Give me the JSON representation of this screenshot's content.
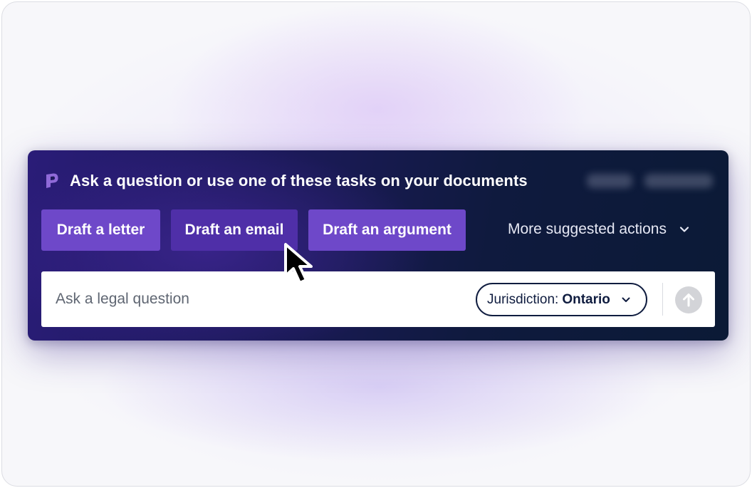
{
  "panel": {
    "heading": "Ask a question or use one of these tasks on your documents",
    "logo_icon": "brand-p-logo-icon"
  },
  "tasks": [
    {
      "label": "Draft a letter"
    },
    {
      "label": "Draft an email"
    },
    {
      "label": "Draft an argument"
    }
  ],
  "more_actions": {
    "label": "More suggested actions",
    "icon": "chevron-down-icon"
  },
  "input": {
    "placeholder": "Ask a legal question",
    "value": ""
  },
  "jurisdiction": {
    "label": "Jurisdiction:",
    "value": "Ontario",
    "icon": "chevron-down-icon"
  },
  "send": {
    "icon": "arrow-up-icon"
  },
  "colors": {
    "panel_bg": "#1c1a5a",
    "task_button": "#6e48c9",
    "task_button_hover": "#4f2fa8",
    "jurisdiction_border": "#0f1c3f",
    "send_disabled": "#d3d4d8"
  }
}
